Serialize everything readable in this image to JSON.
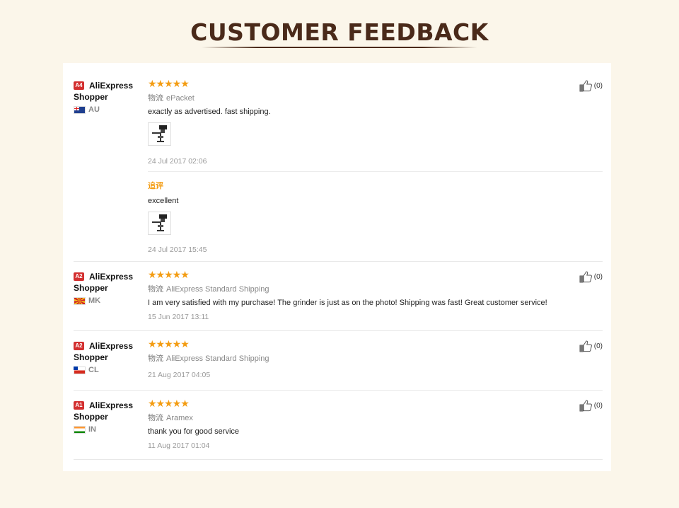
{
  "header": {
    "title": "CUSTOMER FEEDBACK"
  },
  "colors": {
    "star": "#f39c12",
    "badge": "#d32f2f",
    "title": "#4a2a1a"
  },
  "reviews": [
    {
      "badge": "A4",
      "buyer": "AliExpress Shopper",
      "country": "AU",
      "stars": "★★★★★",
      "rating": 5,
      "ship_key": "物流",
      "shipping": "ePacket",
      "text": "exactly as advertised. fast shipping.",
      "date": "24 Jul 2017 02:06",
      "helpful": "(0)",
      "followup": {
        "label": "追评",
        "text": "excellent",
        "date": "24 Jul 2017 15:45"
      }
    },
    {
      "badge": "A2",
      "buyer": "AliExpress Shopper",
      "country": "MK",
      "stars": "★★★★★",
      "rating": 5,
      "ship_key": "物流",
      "shipping": "AliExpress Standard Shipping",
      "text": "I am very satisfied with my purchase! The grinder is just as on the photo! Shipping was fast! Great customer service!",
      "date": "15 Jun 2017 13:11",
      "helpful": "(0)"
    },
    {
      "badge": "A2",
      "buyer": "AliExpress Shopper",
      "country": "CL",
      "stars": "★★★★★",
      "rating": 5,
      "ship_key": "物流",
      "shipping": "AliExpress Standard Shipping",
      "date": "21 Aug 2017 04:05",
      "helpful": "(0)"
    },
    {
      "badge": "A1",
      "buyer": "AliExpress Shopper",
      "country": "IN",
      "stars": "★★★★★",
      "rating": 5,
      "ship_key": "物流",
      "shipping": "Aramex",
      "text": "thank you for good service",
      "date": "11 Aug 2017 01:04",
      "helpful": "(0)"
    }
  ]
}
